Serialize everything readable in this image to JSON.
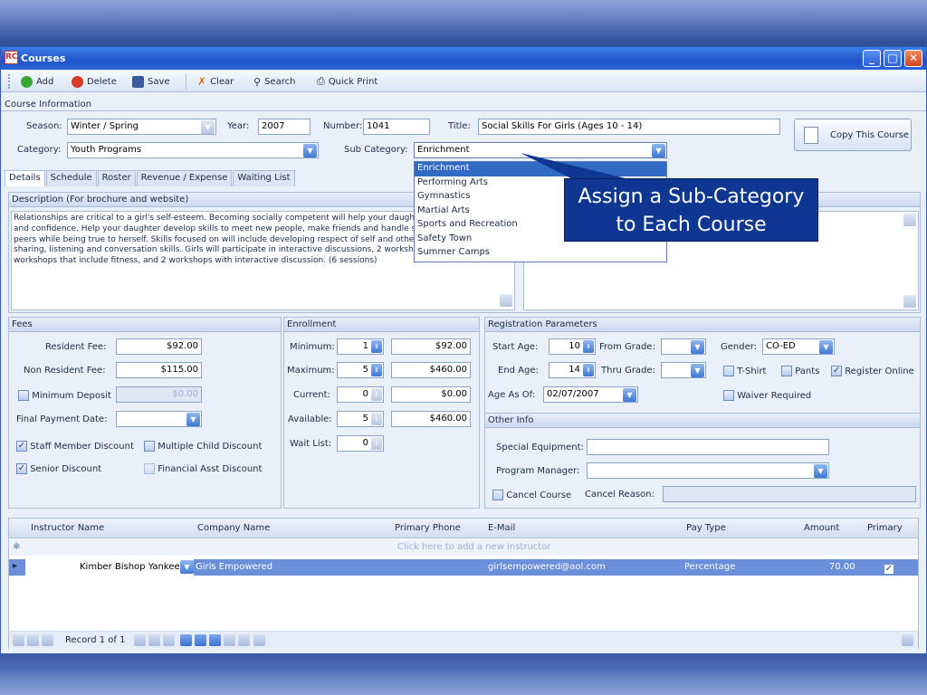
{
  "window": {
    "title": "Courses",
    "logo": "RC"
  },
  "toolbar": {
    "add": "Add",
    "delete": "Delete",
    "save": "Save",
    "clear": "Clear",
    "search": "Search",
    "quick_print": "Quick Print"
  },
  "course_info": {
    "section": "Course Information",
    "season_label": "Season:",
    "season": "Winter / Spring",
    "year_label": "Year:",
    "year": "2007",
    "number_label": "Number:",
    "number": "1041",
    "title_label": "Title:",
    "title": "Social Skills For Girls (Ages 10 - 14)",
    "category_label": "Category:",
    "category": "Youth Programs",
    "subcategory_label": "Sub Category:",
    "subcategory": "Enrichment",
    "copy_button": "Copy This Course"
  },
  "tabs": [
    "Details",
    "Schedule",
    "Roster",
    "Revenue / Expense",
    "Waiting List"
  ],
  "subcategory_options": [
    "Enrichment",
    "Performing Arts",
    "Gymnastics",
    "Martial Arts",
    "Sports and Recreation",
    "Safety Town",
    "Summer Camps"
  ],
  "callout": {
    "line1": "Assign a Sub-Category",
    "line2": "to Each Course"
  },
  "description": {
    "label": "Description (For brochure and website)",
    "text": "Relationships are critical to a girl's self-esteem. Becoming socially competent will help your daughter develop self-esteem and confidence. Help your daughter develop skills to meet new people, make friends and handle sticky situation with peers while being true to herself. Skills focused on will include developing respect of self and others, cooperation, sharing, listening and conversation skills. Girls will participate in interactive discussions, 2 workshops with crafts, 2 workshops that include fitness, and 2 workshops with interactive discussion.  (6 sessions)"
  },
  "fees": {
    "header": "Fees",
    "resident_label": "Resident Fee:",
    "resident": "$92.00",
    "nonresident_label": "Non Resident Fee:",
    "nonresident": "$115.00",
    "min_deposit_label": "Minimum Deposit",
    "min_deposit": "$0.00",
    "final_payment_label": "Final Payment Date:",
    "staff_discount": "Staff Member Discount",
    "multiple_child": "Multiple Child Discount",
    "senior_discount": "Senior Discount",
    "financial_asst": "Financial Asst Discount"
  },
  "enrollment": {
    "header": "Enrollment",
    "min_label": "Minimum:",
    "min": "1",
    "min_amt": "$92.00",
    "max_label": "Maximum:",
    "max": "5",
    "max_amt": "$460.00",
    "current_label": "Current:",
    "current": "0",
    "current_amt": "$0.00",
    "available_label": "Available:",
    "available": "5",
    "available_amt": "$460.00",
    "waitlist_label": "Wait List:",
    "waitlist": "0"
  },
  "registration": {
    "header": "Registration Parameters",
    "start_age_label": "Start Age:",
    "start_age": "10",
    "end_age_label": "End Age:",
    "end_age": "14",
    "from_grade_label": "From Grade:",
    "thru_grade_label": "Thru Grade:",
    "gender_label": "Gender:",
    "gender": "CO-ED",
    "tshirt": "T-Shirt",
    "pants": "Pants",
    "register_online": "Register Online",
    "waiver": "Waiver Required",
    "age_as_of_label": "Age As Of:",
    "age_as_of": "02/07/2007"
  },
  "other_info": {
    "header": "Other Info",
    "special_equipment_label": "Special Equipment:",
    "program_manager_label": "Program Manager:",
    "cancel_course": "Cancel Course",
    "cancel_reason_label": "Cancel Reason:"
  },
  "instructors": {
    "columns": [
      "Instructor Name",
      "Company Name",
      "Primary Phone",
      "E-Mail",
      "Pay Type",
      "Amount",
      "Primary"
    ],
    "new_row_hint": "Click here to add a new instructor",
    "rows": [
      {
        "name": "Kimber Bishop Yankee",
        "company": "Girls Empowered",
        "phone": "",
        "email": "girlsempowered@aol.com",
        "pay_type": "Percentage",
        "amount": "70.00"
      }
    ],
    "record_label": "Record 1 of 1"
  }
}
